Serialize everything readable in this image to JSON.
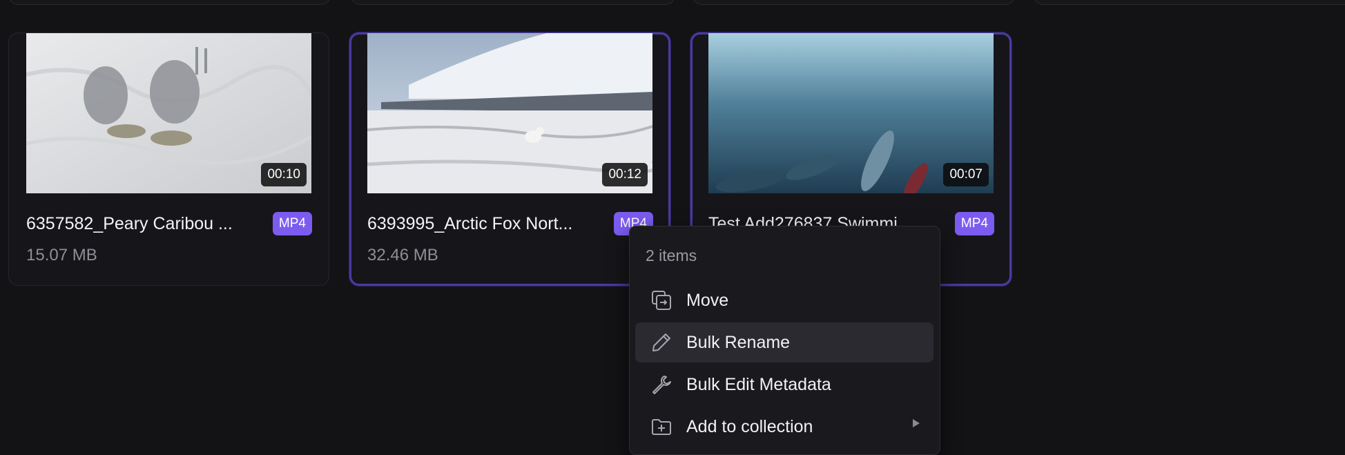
{
  "cards": [
    {
      "name": "6357582_Peary Caribou ...",
      "format": "MP4",
      "size": "15.07 MB",
      "duration": "00:10",
      "selected": false
    },
    {
      "name": "6393995_Arctic Fox Nort...",
      "format": "MP4",
      "size": "32.46 MB",
      "duration": "00:12",
      "selected": true
    },
    {
      "name": "Test Add276837 Swimmi...",
      "format": "MP4",
      "size": "",
      "duration": "00:07",
      "selected": true
    }
  ],
  "context_menu": {
    "header": "2 items",
    "items": [
      {
        "label": "Move",
        "icon": "move-icon"
      },
      {
        "label": "Bulk Rename",
        "icon": "pencil-icon"
      },
      {
        "label": "Bulk Edit Metadata",
        "icon": "wrench-icon"
      },
      {
        "label": "Add to collection",
        "icon": "folder-plus-icon",
        "submenu": true
      }
    ]
  },
  "colors": {
    "background": "#131316",
    "accent": "#7c5cf0",
    "selected_border": "#4a3aa0"
  }
}
